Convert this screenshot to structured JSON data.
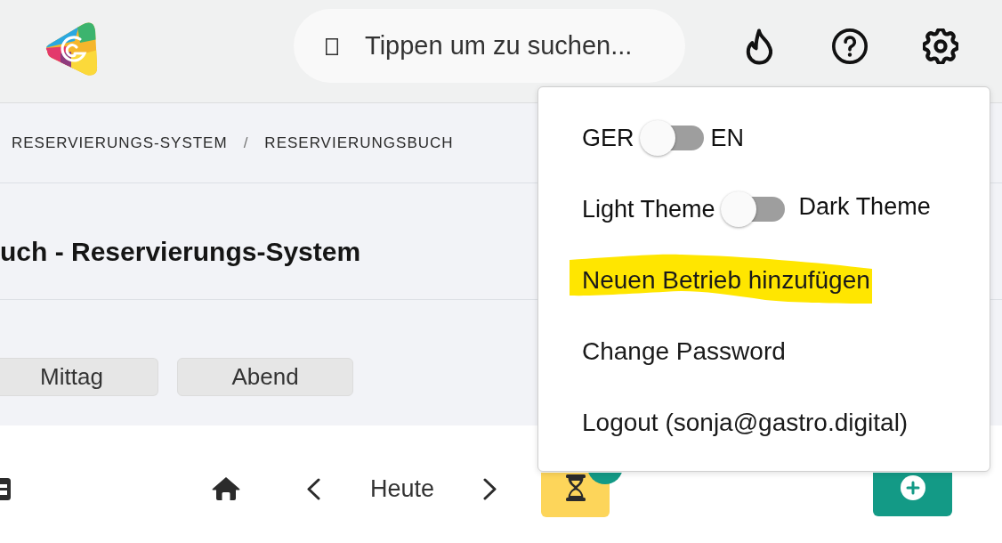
{
  "header": {
    "search": {
      "placeholder": "Tippen um zu suchen..."
    }
  },
  "breadcrumb": {
    "items": [
      "RESERVIERUNGS-SYSTEM",
      "RESERVIERUNGSBUCH"
    ],
    "separator": "/"
  },
  "page_title": "uch - Reservierungs-System",
  "shift_buttons": [
    {
      "label": "Mittag",
      "selected": false
    },
    {
      "label": "Abend",
      "selected": false
    }
  ],
  "toolbar": {
    "today_label": "Heute"
  },
  "settings_menu": {
    "items": [
      {
        "kind": "toggle",
        "label_off": "GER",
        "label_on": "EN",
        "on": false
      },
      {
        "kind": "toggle",
        "label_off": "Light Theme",
        "label_on": "Dark Theme",
        "on": false
      },
      {
        "kind": "link",
        "label": "Neuen Betrieb hinzufügen",
        "highlighted": true
      },
      {
        "kind": "link",
        "label": "Change Password",
        "highlighted": false
      },
      {
        "kind": "link",
        "label": "Logout (sonja@gastro.digital)",
        "highlighted": false
      }
    ]
  }
}
